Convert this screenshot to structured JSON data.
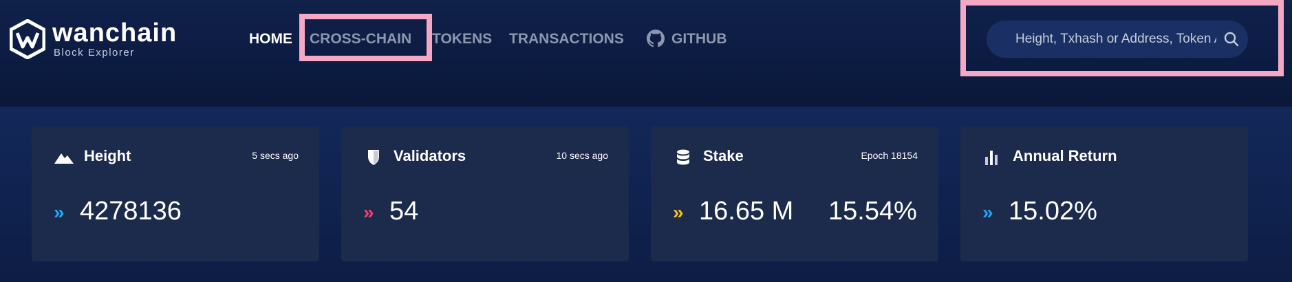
{
  "brand": {
    "name": "wanchain",
    "subtitle": "Block Explorer",
    "logo_icon": "wanchain-logo-icon"
  },
  "nav": {
    "items": [
      {
        "label": "HOME",
        "active": true
      },
      {
        "label": "CROSS-CHAIN",
        "active": false
      },
      {
        "label": "TOKENS",
        "active": false
      },
      {
        "label": "TRANSACTIONS",
        "active": false
      },
      {
        "label": "GITHUB",
        "active": false,
        "icon": "github-icon"
      }
    ]
  },
  "search": {
    "placeholder": "Height, Txhash or Address, Token Address",
    "icon": "search-icon"
  },
  "cards": [
    {
      "title": "Height",
      "meta": "5 secs ago",
      "value": "4278136",
      "icon": "mountain-icon",
      "accent": "#22a7f0"
    },
    {
      "title": "Validators",
      "meta": "10 secs ago",
      "value": "54",
      "icon": "shield-icon",
      "accent": "#e8476f"
    },
    {
      "title": "Stake",
      "meta": "Epoch 18154",
      "value": "16.65 M",
      "value2": "15.54%",
      "icon": "database-icon",
      "accent": "#f5c518"
    },
    {
      "title": "Annual Return",
      "meta": "",
      "value": "15.02%",
      "icon": "bar-chart-icon",
      "accent": "#22a7f0"
    }
  ],
  "colors": {
    "background": "#0b1a3e",
    "card": "#1c2a4c",
    "highlight": "#f4a8c4",
    "nav_inactive": "#8d98ae"
  }
}
